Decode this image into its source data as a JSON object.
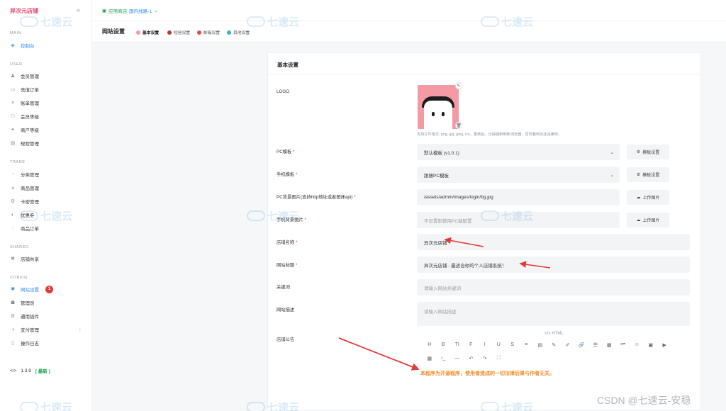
{
  "sidebar": {
    "brand": "异次元店铺",
    "sections": {
      "main": "MAIN",
      "user": "USER",
      "trade": "TRADE",
      "shared": "SHARED",
      "config": "CONFIG"
    },
    "items": {
      "dashboard": "控制台",
      "members": "会员管理",
      "recharge": "充值订单",
      "bills": "账单管理",
      "member_level": "会员等级",
      "merchant_level": "商户等级",
      "regulation": "规程管理",
      "category": "分类管理",
      "products": "商品管理",
      "cards": "卡密管理",
      "coupons": "优惠券",
      "orders": "商品订单",
      "store_share": "店铺共享",
      "site_settings": "网站设置",
      "admins": "管理员",
      "plugins": "通用插件",
      "payment": "支付管理",
      "logs": "操作日志"
    },
    "site_settings_badge": "1",
    "version": "1.3.9",
    "version_status": "[ 最新 ]"
  },
  "topbar": {
    "store_name": "应用商店",
    "line": "国内线路-1"
  },
  "tabs": {
    "title": "网站设置",
    "items": [
      "基本设置",
      "短信设置",
      "邮箱设置",
      "其他设置"
    ]
  },
  "card": {
    "title": "基本设置",
    "logo_label": "LOGO",
    "logo_hint": "支持文件格式: png, jpg, jpeg, ico。更换后，记得强制刷新浏览器，否则看到的还是缓存。",
    "pc_template_label": "PC模板",
    "pc_template_value": "默认模板 (v1.0.1)",
    "template_settings": "模板设置",
    "mobile_template_label": "手机模板",
    "mobile_template_value": "跟随PC模板",
    "pc_bg_label": "PC背景图片(支持http地址或者图床api)",
    "pc_bg_value": "/assets/admin/images/login/bg.jpg",
    "upload_image": "上传图片",
    "mobile_bg_label": "手机背景图片",
    "mobile_bg_placeholder": "不设置则使用PC端配置",
    "store_name_label": "店铺名称",
    "store_name_value": "异次元店铺",
    "site_title_label": "网站标题",
    "site_title_value": "异次元店铺 - 最适合你的个人店铺系统！",
    "keywords_label": "关键词",
    "keywords_placeholder": "请输入网站关键词",
    "description_label": "网站描述",
    "description_placeholder": "请输入网站描述",
    "notice_label": "店铺公告",
    "editor_tag": "</> HTML",
    "toolbar_row1": [
      "H",
      "B",
      "TI",
      "F",
      "I",
      "U",
      "S",
      "≡",
      "▤",
      "✎",
      "✐",
      "🔗",
      "☰",
      "▦",
      "❝❞",
      "☺",
      "▣",
      "▶"
    ],
    "toolbar_row2": [
      "▦",
      "›_",
      "—",
      "↶",
      "↷",
      "⛶"
    ]
  },
  "notice": "本程序为开源程序，使用者造成的一切法律后果与作者无关。",
  "watermark": "七速云",
  "footer_credit": "CSDN @七速云-安稳",
  "colors": {
    "accent": "#2f8cf0",
    "brand": "#e8496b",
    "notice": "#f08a24",
    "annotation": "#e33b3b"
  }
}
